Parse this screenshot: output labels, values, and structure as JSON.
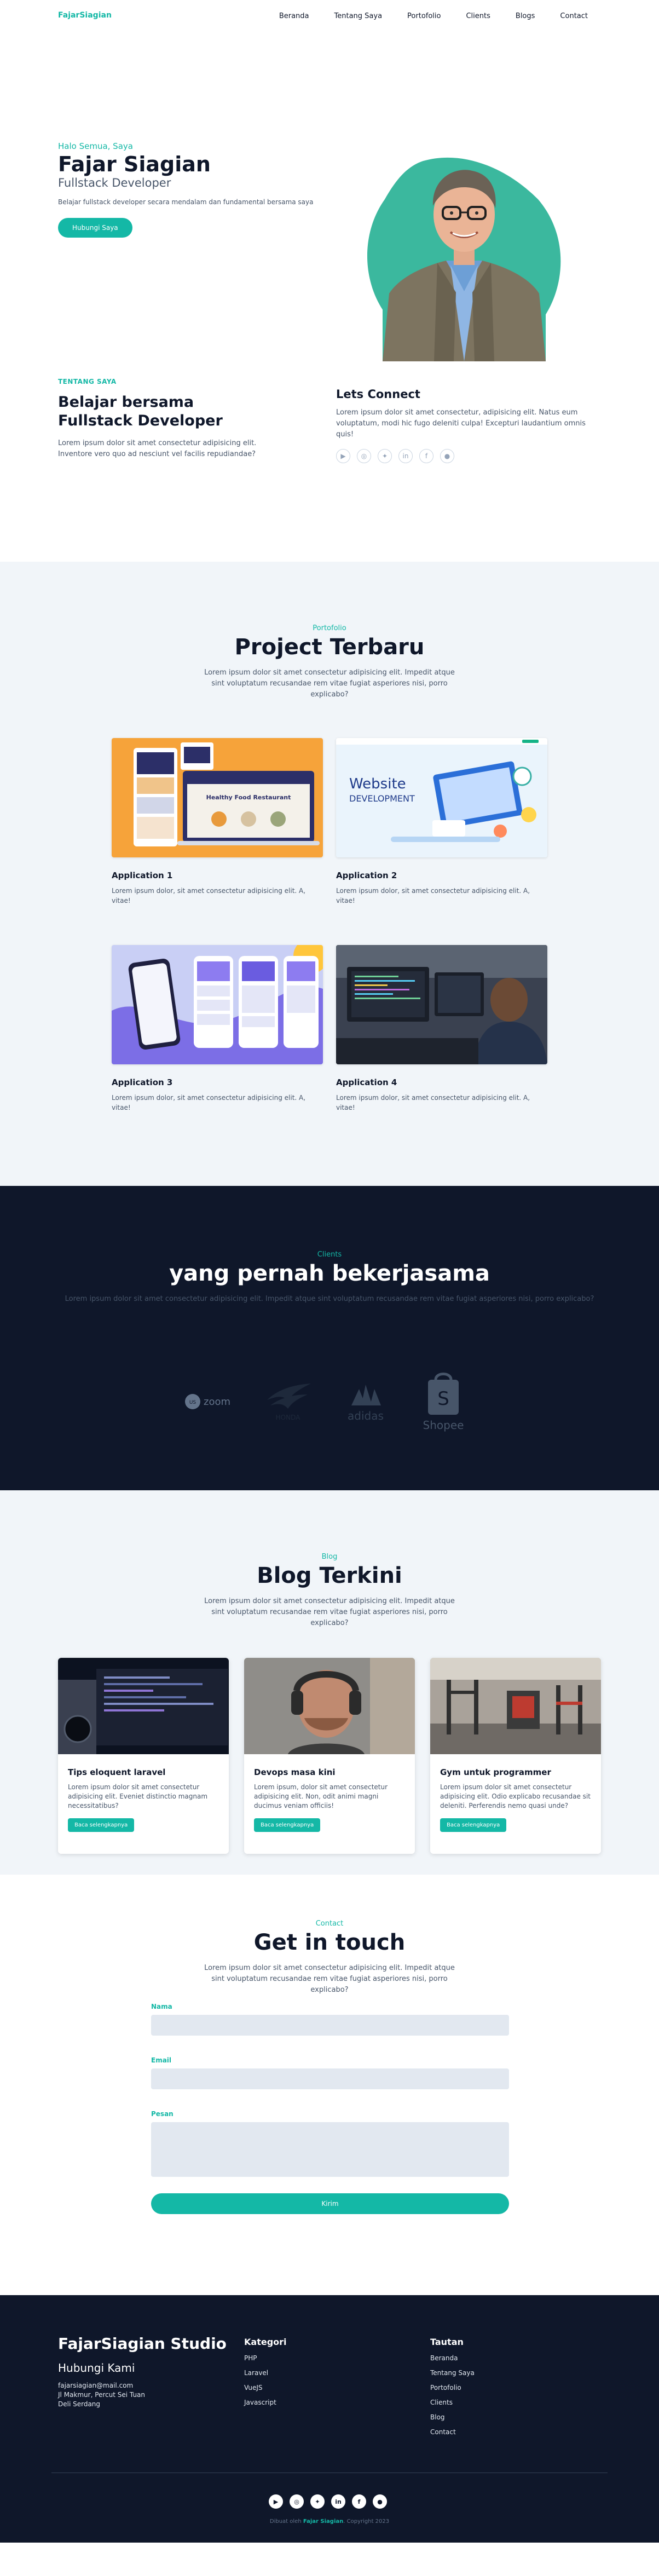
{
  "header": {
    "logo": "FajarSiagian",
    "nav": [
      "Beranda",
      "Tentang Saya",
      "Portofolio",
      "Clients",
      "Blogs",
      "Contact"
    ]
  },
  "hero": {
    "greeting": "Halo Semua, Saya",
    "name": "Fajar Siagian",
    "role": "Fullstack Developer",
    "desc": "Belajar fullstack developer secara mendalam dan fundamental bersama saya",
    "cta": "Hubungi Saya"
  },
  "about": {
    "tag": "TENTANG SAYA",
    "title_line1": "Belajar bersama",
    "title_line2": "Fullstack Developer",
    "desc": "Lorem ipsum dolor sit amet consectetur adipisicing elit. Inventore vero quo ad nesciunt vel facilis repudiandae?",
    "connect_title": "Lets Connect",
    "connect_desc": "Lorem ipsum dolor sit amet consectetur, adipisicing elit. Natus eum voluptatum, modi hic fugo deleniti culpa! Excepturi laudantium omnis quis!",
    "social_icons": [
      "youtube-icon",
      "instagram-icon",
      "twitter-icon",
      "linkedin-icon",
      "facebook-icon",
      "github-icon"
    ]
  },
  "portfolio": {
    "tag": "Portofolio",
    "title": "Project Terbaru",
    "desc": "Lorem ipsum dolor sit amet consectetur adipisicing elit. Impedit atque sint voluptatum recusandae rem vitae fugiat asperiores nisi, porro explicabo?",
    "items": [
      {
        "name": "Application 1",
        "desc": "Lorem ipsum dolor, sit amet consectetur adipisicing elit. A, vitae!"
      },
      {
        "name": "Application 2",
        "desc": "Lorem ipsum dolor, sit amet consectetur adipisicing elit. A, vitae!",
        "image_text_1": "Website",
        "image_text_2": "DEVELOPMENT"
      },
      {
        "name": "Application 3",
        "desc": "Lorem ipsum dolor, sit amet consectetur adipisicing elit. A, vitae!"
      },
      {
        "name": "Application 4",
        "desc": "Lorem ipsum dolor, sit amet consectetur adipisicing elit. A, vitae!"
      }
    ],
    "app1_image_texts": [
      "Healthy Food Restaurant"
    ]
  },
  "clients": {
    "tag": "Clients",
    "title": "yang pernah bekerjasama",
    "desc": "Lorem ipsum dolor sit amet consectetur adipisicing elit. Impedit atque sint voluptatum recusandae rem vitae fugiat asperiores nisi, porro explicabo?",
    "logos": {
      "zoom": "zoom",
      "zoom_badge": "US",
      "honda": "HONDA",
      "adidas": "adidas",
      "shopee": "Shopee",
      "shopee_mark": "S"
    }
  },
  "blog": {
    "tag": "Blog",
    "title": "Blog Terkini",
    "desc": "Lorem ipsum dolor sit amet consectetur adipisicing elit. Impedit atque sint voluptatum recusandae rem vitae fugiat asperiores nisi, porro explicabo?",
    "posts": [
      {
        "title": "Tips eloquent laravel",
        "desc": "Lorem ipsum dolor sit amet consectetur adipisicing elit. Eveniet distinctio magnam necessitatibus?",
        "button": "Baca selengkapnya"
      },
      {
        "title": "Devops masa kini",
        "desc": "Lorem ipsum, dolor sit amet consectetur adipisicing elit. Non, odit animi magni ducimus veniam officiis!",
        "button": "Baca selengkapnya"
      },
      {
        "title": "Gym untuk programmer",
        "desc": "Lorem ipsum dolor sit amet consectetur adipisicing elit. Odio explicabo recusandae sit deleniti. Perferendis nemo quasi unde?",
        "button": "Baca selengkapnya"
      }
    ]
  },
  "contact": {
    "tag": "Contact",
    "title": "Get in touch",
    "desc": "Lorem ipsum dolor sit amet consectetur adipisicing elit. Impedit atque sint voluptatum recusandae rem vitae fugiat asperiores nisi, porro explicabo?",
    "name_label": "Nama",
    "email_label": "Email",
    "message_label": "Pesan",
    "submit": "Kirim"
  },
  "footer": {
    "brand": "FajarSiagian Studio",
    "sub": "Hubungi Kami",
    "email": "fajarsiagian@mail.com",
    "address1": "Jl Makmur, Percut Sei Tuan",
    "address2": "Deli Serdang",
    "kategori_title": "Kategori",
    "kategori": [
      "PHP",
      "Laravel",
      "VueJS",
      "Javascript"
    ],
    "tautan_title": "Tautan",
    "tautan": [
      "Beranda",
      "Tentang Saya",
      "Portofolio",
      "Clients",
      "Blog",
      "Contact"
    ],
    "social_icons": [
      "youtube-icon",
      "instagram-icon",
      "twitter-icon",
      "linkedin-icon",
      "facebook-icon",
      "github-icon"
    ],
    "copy_prefix": "Dibuat oleh",
    "copy_name": "Fajar Siagian",
    "copy_suffix": ". Copyright 2023"
  },
  "colors": {
    "accent": "#14b8a6",
    "dark": "#0f172a",
    "light_bg": "#f1f5f9"
  }
}
